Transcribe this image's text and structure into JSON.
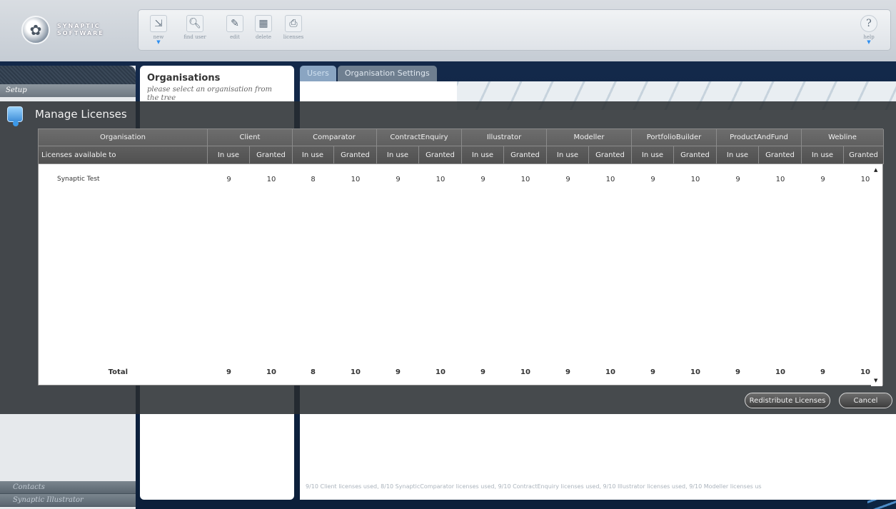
{
  "brand": {
    "line1": "SYNAPTIC",
    "line2": "SOFTWARE"
  },
  "toolbar": {
    "buttons": [
      {
        "label": "new",
        "icon": "new-icon"
      },
      {
        "label": "find user",
        "icon": "find-user-icon"
      },
      {
        "label": "edit",
        "icon": "edit-icon"
      },
      {
        "label": "delete",
        "icon": "delete-icon"
      },
      {
        "label": "licenses",
        "icon": "licenses-icon"
      }
    ],
    "help_label": "help"
  },
  "sidebar": {
    "setup_label": "Setup",
    "bottom": [
      "Contacts",
      "Synaptic Illustrator"
    ]
  },
  "organisations": {
    "title": "Organisations",
    "subtitle": "please select an organisation from the tree"
  },
  "main": {
    "tabs": [
      "Users",
      "Organisation Settings"
    ],
    "status_line": "9/10 Client licenses used,   8/10 SynapticComparator licenses used,   9/10 ContractEnquiry licenses used,   9/10 Illustrator licenses used,   9/10 Modeller licenses us"
  },
  "modal": {
    "title": "Manage Licenses",
    "header": {
      "org_top": "Organisation",
      "org_bottom": "Licenses available to",
      "in_use": "In use",
      "granted": "Granted"
    },
    "products": [
      "Client",
      "Comparator",
      "ContractEnquiry",
      "Illustrator",
      "Modeller",
      "PortfolioBuilder",
      "ProductAndFund",
      "Webline"
    ],
    "rows": [
      {
        "name": "Synaptic Test",
        "values": [
          "9",
          "10",
          "8",
          "10",
          "9",
          "10",
          "9",
          "10",
          "9",
          "10",
          "9",
          "10",
          "9",
          "10",
          "9",
          "10"
        ]
      }
    ],
    "total": {
      "label": "Total",
      "values": [
        "9",
        "10",
        "8",
        "10",
        "9",
        "10",
        "9",
        "10",
        "9",
        "10",
        "9",
        "10",
        "9",
        "10",
        "9",
        "10"
      ]
    },
    "buttons": {
      "redistribute": "Redistribute Licenses",
      "cancel": "Cancel"
    }
  }
}
